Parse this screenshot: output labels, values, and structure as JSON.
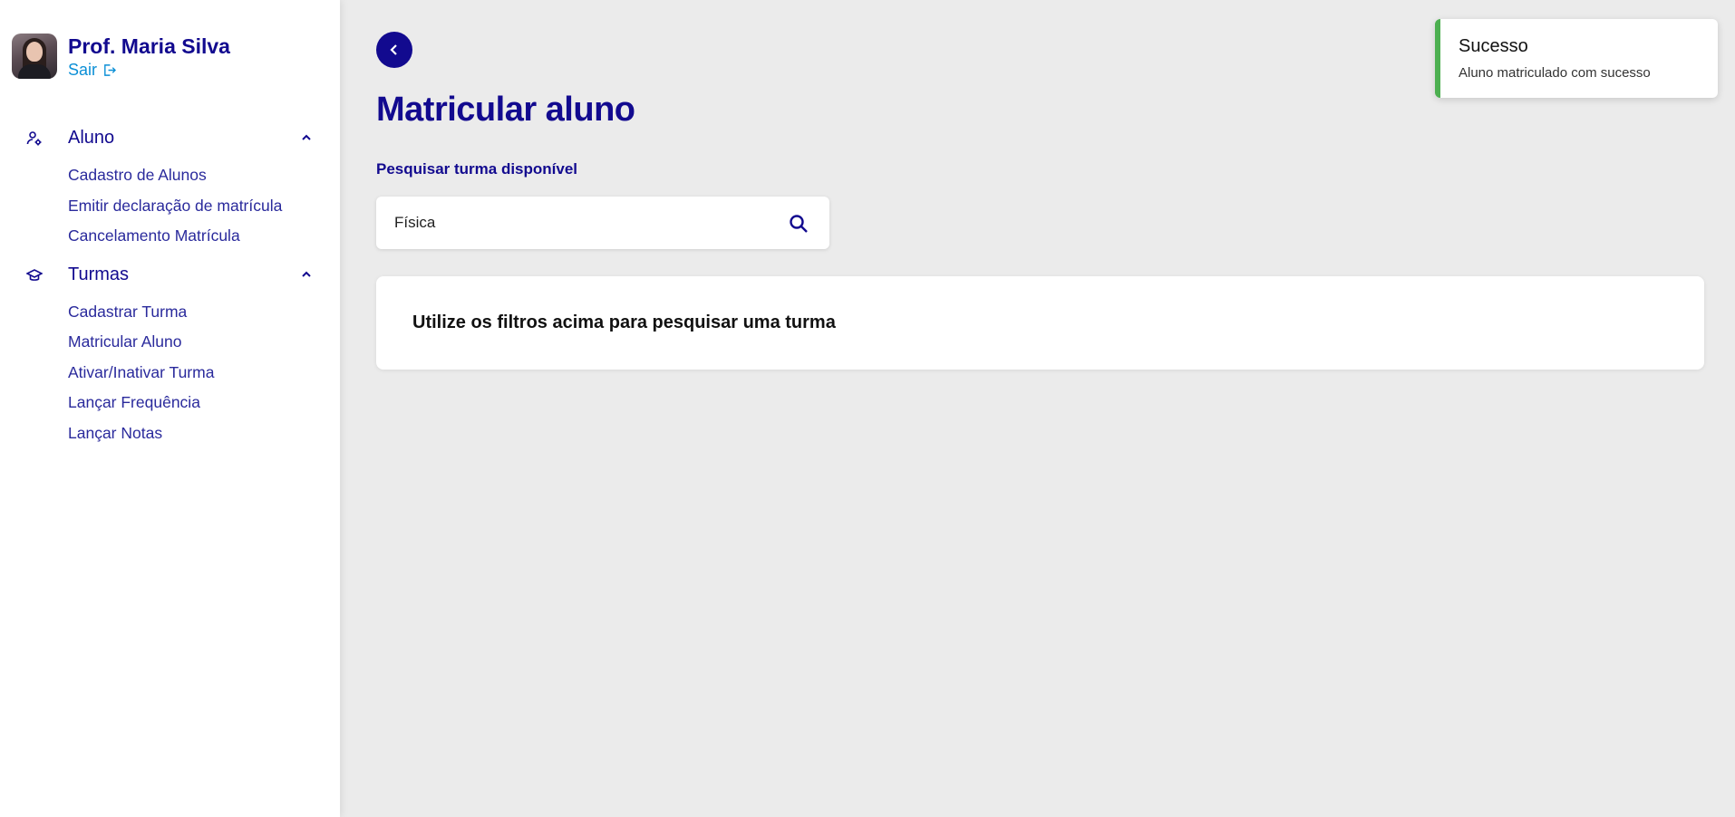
{
  "profile": {
    "name": "Prof. Maria Silva",
    "logout_label": "Sair"
  },
  "sidebar": {
    "sections": [
      {
        "label": "Aluno",
        "icon": "user-gear-icon",
        "items": [
          {
            "label": "Cadastro de Alunos"
          },
          {
            "label": "Emitir declaração de matrícula"
          },
          {
            "label": "Cancelamento Matrícula"
          }
        ]
      },
      {
        "label": "Turmas",
        "icon": "graduation-cap-icon",
        "items": [
          {
            "label": "Cadastrar Turma"
          },
          {
            "label": "Matricular Aluno"
          },
          {
            "label": "Ativar/Inativar Turma"
          },
          {
            "label": "Lançar Frequência"
          },
          {
            "label": "Lançar Notas"
          }
        ]
      }
    ]
  },
  "main": {
    "title": "Matricular aluno",
    "search": {
      "label": "Pesquisar turma disponível",
      "value": "Física"
    },
    "empty_message": "Utilize os filtros acima para pesquisar uma turma"
  },
  "toast": {
    "title": "Sucesso",
    "message": "Aluno matriculado com sucesso",
    "accent_color": "#4caf50"
  },
  "colors": {
    "primary": "#120a8f",
    "link": "#0b8fd6",
    "background": "#ebebeb"
  }
}
